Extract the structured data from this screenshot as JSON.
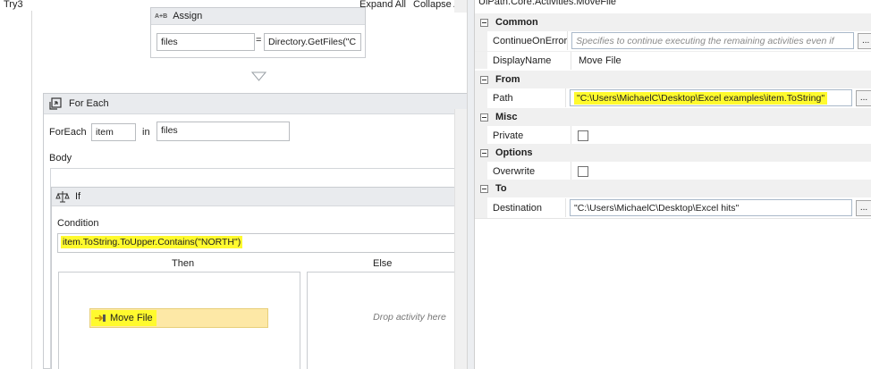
{
  "designer": {
    "title": "Try3",
    "expand_all": "Expand All",
    "collapse_all": "Collapse All",
    "assign": {
      "badge": "A+B",
      "title": "Assign",
      "to": "files",
      "equals": "=",
      "value": "Directory.GetFiles(\"C"
    },
    "foreach": {
      "title": "For Each",
      "foreach_label": "ForEach",
      "item_value": "item",
      "in_label": "in",
      "collection_value": "files",
      "body_label": "Body"
    },
    "if_activity": {
      "title": "If",
      "condition_label": "Condition",
      "condition_value": "item.ToString.ToUpper.Contains(\"NORTH\")",
      "then_label": "Then",
      "else_label": "Else",
      "drop_hint": "Drop activity here",
      "move_file_label": "Move File"
    }
  },
  "properties": {
    "header": "UiPath.Core.Activities.MoveFile",
    "categories": [
      {
        "name": "Common",
        "props": [
          {
            "name": "ContinueOnError",
            "value": "Specifies to continue executing the remaining activities even if",
            "kind": "input-placeholder"
          },
          {
            "name": "DisplayName",
            "value": "Move File",
            "kind": "text"
          }
        ]
      },
      {
        "name": "From",
        "props": [
          {
            "name": "Path",
            "value": "\"C:\\Users\\MichaelC\\Desktop\\Excel examples\\item.ToString\"",
            "kind": "input-highlight"
          }
        ]
      },
      {
        "name": "Misc",
        "props": [
          {
            "name": "Private",
            "value": "",
            "kind": "checkbox"
          }
        ]
      },
      {
        "name": "Options",
        "props": [
          {
            "name": "Overwrite",
            "value": "",
            "kind": "checkbox"
          }
        ]
      },
      {
        "name": "To",
        "props": [
          {
            "name": "Destination",
            "value": "\"C:\\Users\\MichaelC\\Desktop\\Excel hits\"",
            "kind": "input"
          }
        ]
      }
    ],
    "dots_label": "..."
  },
  "colors": {
    "highlight": "#fffa2e",
    "move_file_bg": "#fde8a6",
    "header_gray": "#e9ebee"
  }
}
